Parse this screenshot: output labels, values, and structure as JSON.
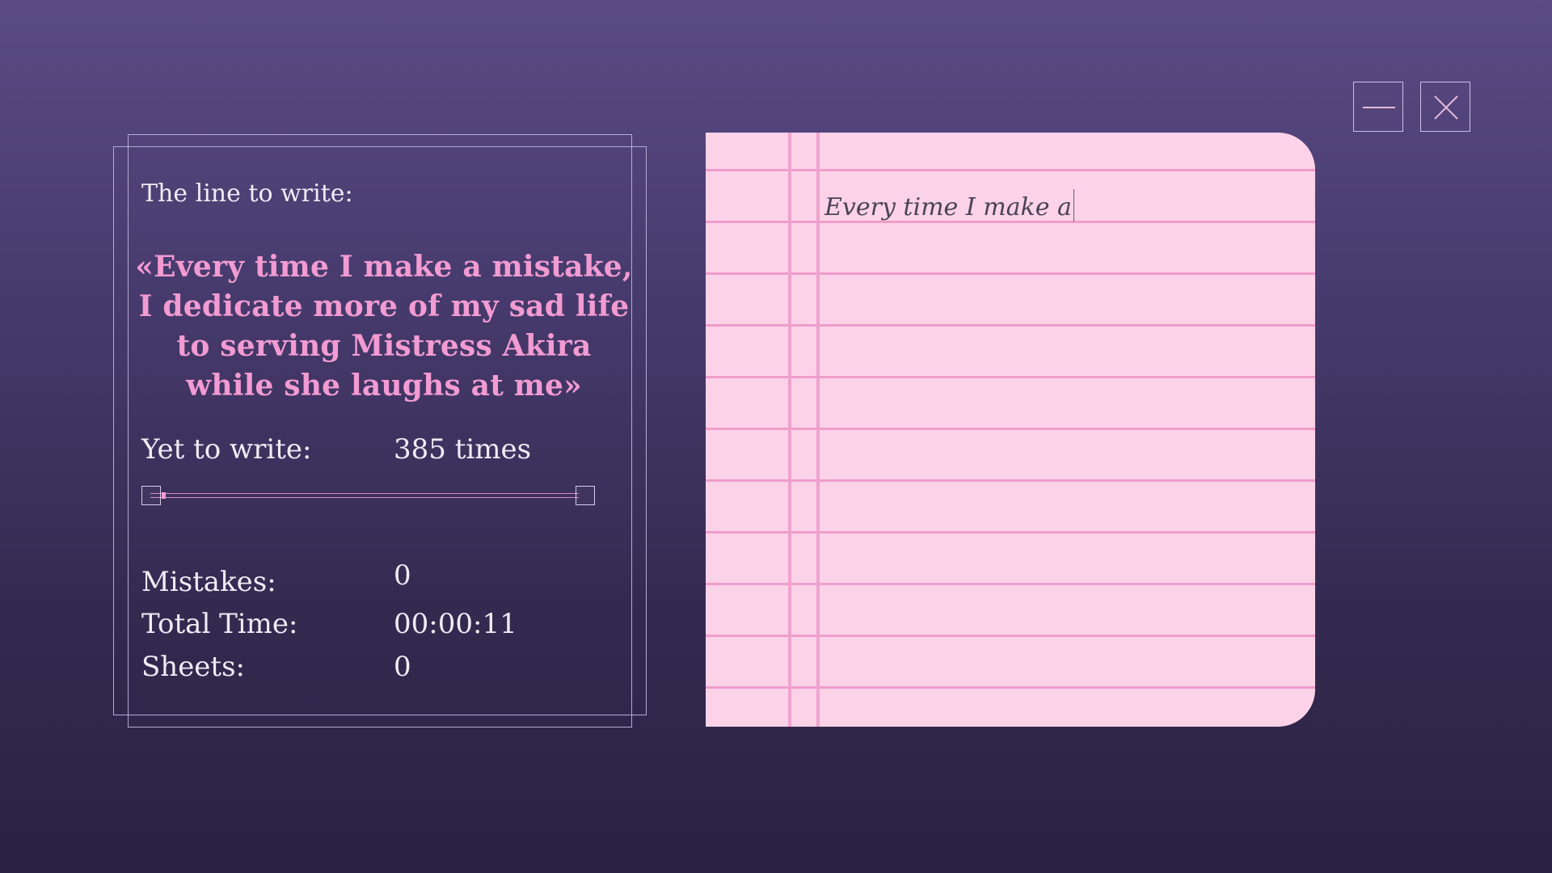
{
  "panel": {
    "line_label": "The line to write:",
    "line_text": "«Every time I make a mistake, I dedicate more of my sad life to serving Mistress Akira while she laughs at me»",
    "yet_label": "Yet to write:",
    "yet_value": "385 times",
    "progress_fraction": 0.01,
    "mistakes_label": "Mistakes:",
    "mistakes_value": "0",
    "time_label": "Total Time:",
    "time_value": "00:00:11",
    "sheets_label": "Sheets:",
    "sheets_value": "0"
  },
  "paper": {
    "typed_text": "Every time I make a"
  },
  "window_controls": {
    "minimize_icon": "minimize-icon",
    "close_icon": "close-icon"
  },
  "colors": {
    "accent_pink": "#f29bd2",
    "paper_pink": "#fbd2e8",
    "background_top": "#5a4b84",
    "background_bottom": "#2a2242"
  }
}
